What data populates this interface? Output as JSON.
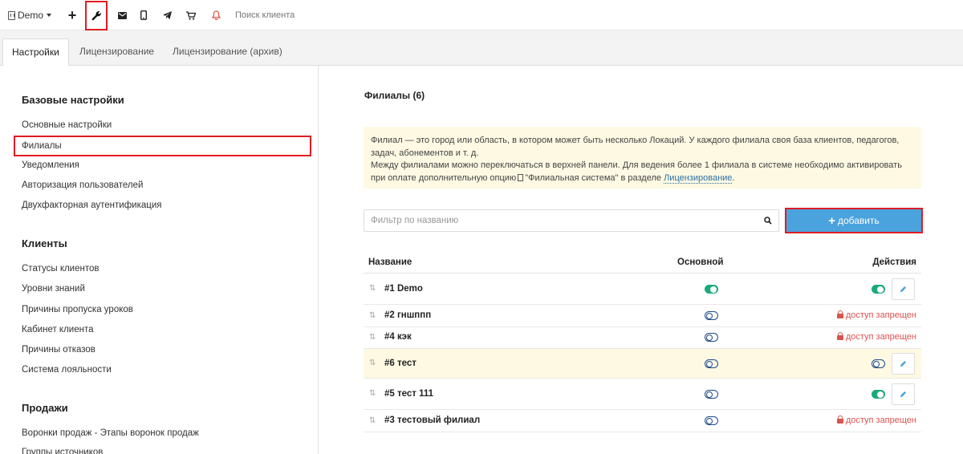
{
  "toolbar": {
    "demo_label": "Demo",
    "plus_label": "+",
    "search_placeholder": "Поиск клиента",
    "icons": [
      "building-icon",
      "plus-icon",
      "wrench-icon",
      "mail-icon",
      "phone-icon",
      "send-icon",
      "cart-icon",
      "bell-icon"
    ],
    "bell_color": "#e74c3c"
  },
  "tabs": [
    {
      "label": "Настройки",
      "active": true
    },
    {
      "label": "Лицензирование",
      "active": false
    },
    {
      "label": "Лицензирование (архив)",
      "active": false
    }
  ],
  "sidebar": {
    "groups": [
      {
        "title": "Базовые настройки",
        "items": [
          "Основные настройки",
          "Филиалы",
          "Уведомления",
          "Авторизация пользователей",
          "Двухфакторная аутентификация"
        ]
      },
      {
        "title": "Клиенты",
        "items": [
          "Статусы клиентов",
          "Уровни знаний",
          "Причины пропуска уроков",
          "Кабинет клиента",
          "Причины отказов",
          "Система лояльности"
        ]
      },
      {
        "title": "Продажи",
        "items": [
          "Воронки продаж - Этапы воронок продаж",
          "Группы источников"
        ]
      }
    ],
    "active_item": "Филиалы"
  },
  "main": {
    "title": "Филиалы (6)",
    "note": {
      "line1": "Филиал — это город или область, в котором может быть несколько Локаций. У каждого филиала своя база клиентов, педагогов,",
      "line2": "задач, абонементов и т. д.",
      "line3": "Между филиалами можно переключаться в верхней панели. Для ведения более 1 филиала в системе необходимо активировать",
      "line4_pre": "при оплате дополнительную опцию",
      "line4_mid": "\"Филиальная система\" в разделе",
      "link": "Лицензирование",
      "line4_end": "."
    },
    "filter_placeholder": "Фильтр по названию",
    "add_label": "добавить",
    "accent_color": "#4aa3dc",
    "table": {
      "headers": {
        "name": "Название",
        "main": "Основной",
        "actions": "Действия"
      },
      "rows": [
        {
          "name": "#1 Demo",
          "main_on": true,
          "action": "edit",
          "action_toggle_on": true,
          "highlight": false
        },
        {
          "name": "#2 гншппп",
          "main_on": false,
          "action": "denied",
          "highlight": false
        },
        {
          "name": "#4 кэк",
          "main_on": false,
          "action": "denied",
          "highlight": false
        },
        {
          "name": "#6 тест",
          "main_on": false,
          "action": "edit",
          "action_toggle_on": false,
          "highlight": true
        },
        {
          "name": "#5 тест 111",
          "main_on": false,
          "action": "edit",
          "action_toggle_on": true,
          "highlight": false
        },
        {
          "name": "#3 тестовый филиал",
          "main_on": false,
          "action": "denied",
          "highlight": false
        }
      ],
      "denied_label": "доступ запрещен"
    }
  }
}
